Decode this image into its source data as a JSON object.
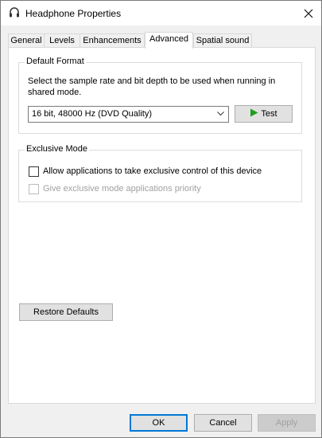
{
  "window": {
    "title": "Headphone Properties",
    "icon": "headphone-icon"
  },
  "tabs": [
    {
      "label": "General",
      "active": false
    },
    {
      "label": "Levels",
      "active": false
    },
    {
      "label": "Enhancements",
      "active": false
    },
    {
      "label": "Advanced",
      "active": true
    },
    {
      "label": "Spatial sound",
      "active": false
    }
  ],
  "default_format": {
    "group_label": "Default Format",
    "description": "Select the sample rate and bit depth to be used when running in shared mode.",
    "selected_format": "16 bit, 48000 Hz (DVD Quality)",
    "test_label": "Test"
  },
  "exclusive_mode": {
    "group_label": "Exclusive Mode",
    "allow_label": "Allow applications to take exclusive control of this device",
    "allow_checked": false,
    "priority_label": "Give exclusive mode applications priority",
    "priority_checked": false,
    "priority_enabled": false
  },
  "buttons": {
    "restore_defaults": "Restore Defaults",
    "ok": "OK",
    "cancel": "Cancel",
    "apply": "Apply"
  },
  "colors": {
    "accent": "#0078d7",
    "test_play": "#1e9e1e"
  }
}
